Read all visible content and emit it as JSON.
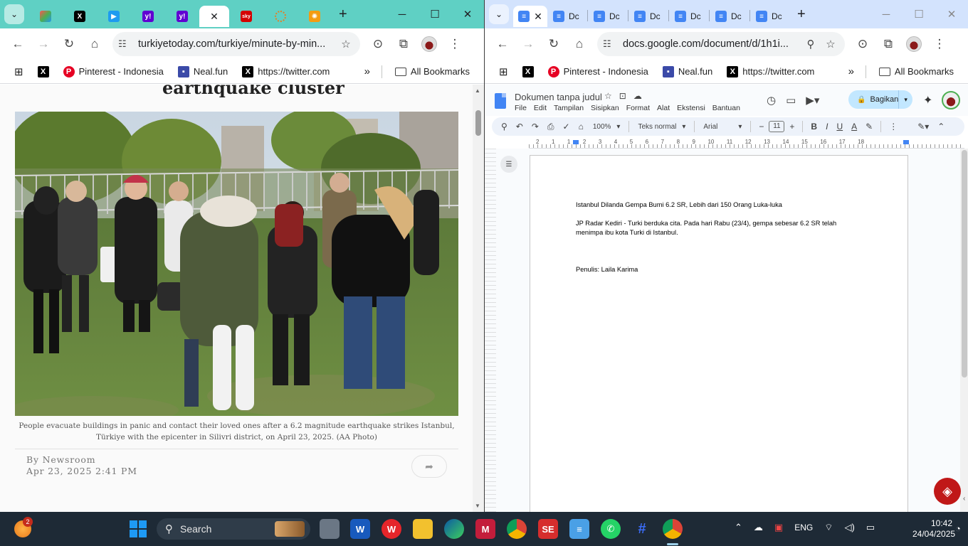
{
  "left_window": {
    "tabs": [
      {
        "icon": "colorful-chart-icon",
        "color": "#ff5252"
      },
      {
        "icon": "x-icon",
        "color": "#000000"
      },
      {
        "icon": "blue-bird-icon",
        "color": "#1da1f2"
      },
      {
        "icon": "yahoo-icon",
        "color": "#6001d2"
      },
      {
        "icon": "yahoo-icon",
        "color": "#6001d2"
      },
      {
        "icon": "active-tab",
        "active": true
      },
      {
        "icon": "sky-news-icon",
        "color": "#d40000",
        "label": "sky"
      },
      {
        "icon": "orange-ring-icon",
        "color": "#e67e22"
      },
      {
        "icon": "fire-icon",
        "color": "#f39c12"
      }
    ],
    "url": "turkiyetoday.com/turkiye/minute-by-min...",
    "bookmarks": [
      {
        "label": "Pinterest - Indonesia",
        "icon": "pinterest-icon"
      },
      {
        "label": "Neal.fun",
        "icon": "neal-fun-icon"
      },
      {
        "label": "https://twitter.com",
        "icon": "x-icon"
      }
    ],
    "all_bookmarks": "All Bookmarks",
    "article": {
      "headline_fragment": "earthquake cluster",
      "caption": "People evacuate buildings in panic and contact their loved ones after a 6.2 magnitude earthquake strikes Istanbul, Türkiye with the epicenter in Silivri district, on April 23, 2025. (AA Photo)",
      "byline": "By Newsroom",
      "date": "Apr 23, 2025 2:41 PM"
    }
  },
  "right_window": {
    "tab_label": "Dc",
    "url": "docs.google.com/document/d/1h1i...",
    "bookmarks": [
      {
        "label": "Pinterest - Indonesia",
        "icon": "pinterest-icon"
      },
      {
        "label": "Neal.fun",
        "icon": "neal-fun-icon"
      },
      {
        "label": "https://twitter.com",
        "icon": "x-icon"
      }
    ],
    "all_bookmarks": "All Bookmarks",
    "docs": {
      "title": "Dokumen tanpa judul",
      "menu": [
        "File",
        "Edit",
        "Tampilan",
        "Sisipkan",
        "Format",
        "Alat",
        "Ekstensi",
        "Bantuan"
      ],
      "share_label": "Bagikan",
      "zoom": "100%",
      "style": "Teks normal",
      "font": "Arial",
      "font_size": "11",
      "ruler_numbers": [
        "2",
        "1",
        "1",
        "2",
        "3",
        "4",
        "5",
        "6",
        "7",
        "8",
        "9",
        "10",
        "11",
        "12",
        "13",
        "14",
        "15",
        "16",
        "17",
        "18"
      ],
      "lines": [
        "Istanbul Dilanda Gempa Bumi 6.2 SR, Lebih dari 150 Orang Luka-luka",
        "JP Radar Kediri - Turki berduka cita. Pada hari Rabu (23/4), gempa sebesar 6.2 SR telah",
        "menimpa ibu kota Turki di Istanbul.",
        "Penulis: Laila Karima"
      ]
    }
  },
  "taskbar": {
    "weather_badge": "2",
    "search_label": "Search",
    "tray_language": "ENG",
    "time": "10:42",
    "date": "24/04/2025"
  }
}
